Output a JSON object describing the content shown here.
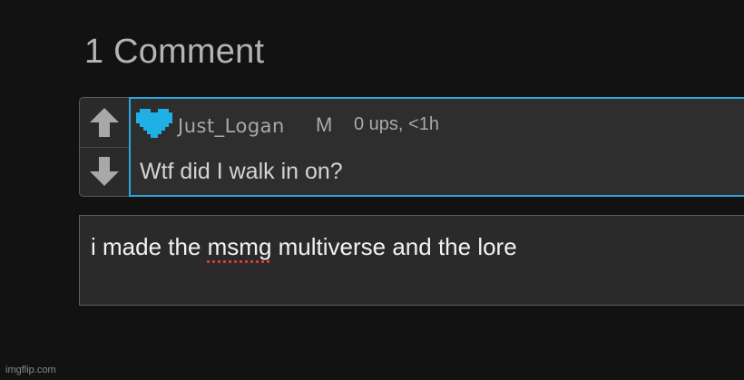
{
  "header": {
    "comment_count_label": "1 Comment"
  },
  "comment": {
    "author": "Just_Logan",
    "badge": "M",
    "meta": "0 ups, <1h",
    "text": "Wtf did I walk in on?",
    "icons": {
      "upvote": "up-arrow-icon",
      "downvote": "down-arrow-icon",
      "avatar": "pixel-heart-icon"
    },
    "colors": {
      "highlight_border": "#2aa7d8",
      "heart": "#1fb0e8"
    }
  },
  "reply": {
    "before": "i made the ",
    "misspelled": "msmg",
    "after": " multiverse and the lore"
  },
  "footer": {
    "watermark": "imgflip.com"
  }
}
